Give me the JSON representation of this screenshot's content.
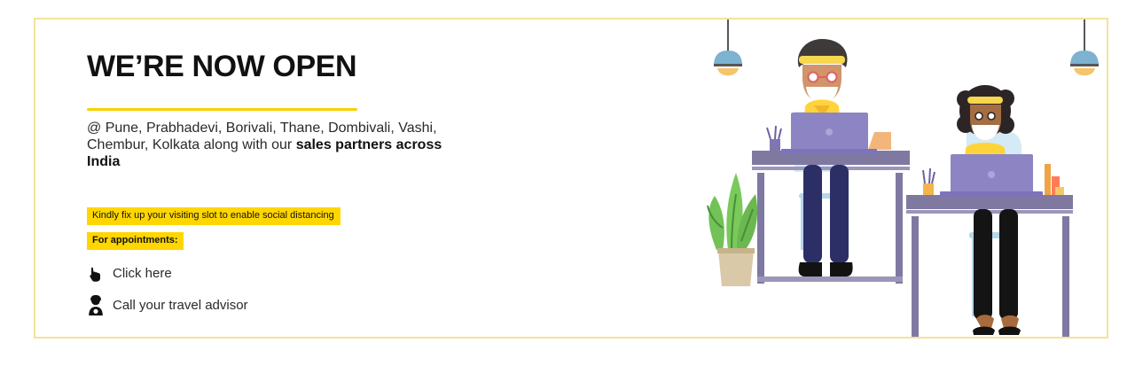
{
  "banner": {
    "headline": "WE’RE NOW OPEN",
    "locations_text": "@ Pune, Prabhadevi, Borivali, Thane, Dombivali, Vashi, Chembur, Kolkata along with our ",
    "locations_highlight": "sales partners across India",
    "notice": "Kindly fix up your visiting slot to enable social distancing",
    "appointments_label": "For appointments:",
    "click_here_label": "Click here",
    "advisor_label": "Call your travel advisor"
  },
  "icons": {
    "click_here": "hand-pointer-icon",
    "advisor": "advisor-phone-icon",
    "lamp": "pendant-lamp-icon",
    "plant": "plant-icon",
    "laptop": "laptop-icon"
  },
  "colors": {
    "accent": "#ffd600",
    "border": "#f4e29a",
    "desk": "#7f79a2",
    "laptop": "#8d84c3",
    "plant": "#78c85a",
    "chair": "#cfe8f4",
    "skin": "#b87a4b",
    "text": "#1f1f1f"
  }
}
